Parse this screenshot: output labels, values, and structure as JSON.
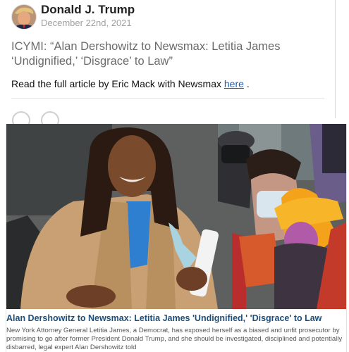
{
  "post": {
    "author": "Donald J. Trump",
    "date": "December 22nd, 2021",
    "headline": "ICYMI: “Alan Dershowitz to Newsmax: Letitia James ‘Undignified,’ ‘Disgrace’ to Law”",
    "read_prefix": "Read the full article by Eric Mack with Newsmax",
    "read_link": "here",
    "read_suffix": "."
  },
  "article_card": {
    "title": "Alan Dershowitz to Newsmax: Letitia James 'Undignified,' 'Disgrace' to Law",
    "description": "New York Attorney General Letitia James, a Democrat, has exposed herself as a biased and unfit prosecutor by promising to go after former President Donald Trump, and she should be investigated, disciplined and potentially disbarred, legal expert Alan Dershowitz told"
  },
  "colors": {
    "link": "#1a5ec2",
    "card_title": "#1e4e79",
    "date": "#a0a0a0"
  }
}
